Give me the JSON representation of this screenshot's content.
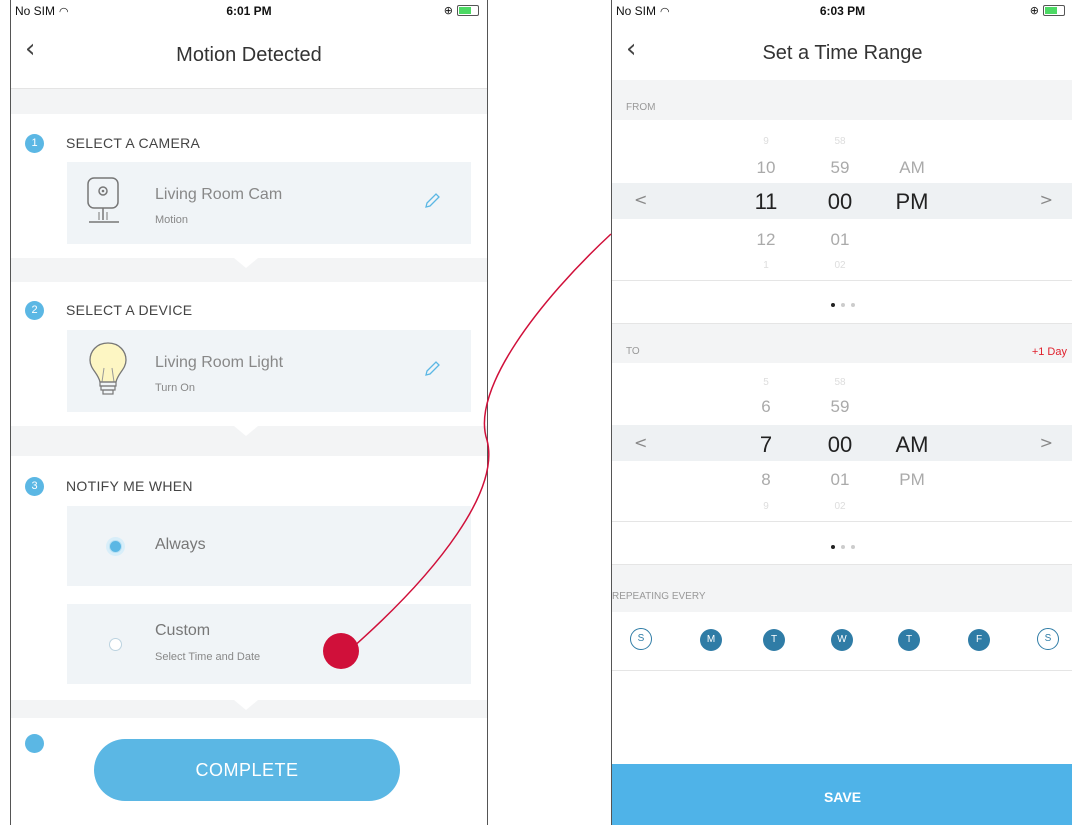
{
  "left": {
    "status": {
      "carrier": "No SIM",
      "time": "6:01 PM"
    },
    "title": "Motion Detected",
    "steps": [
      {
        "num": "1",
        "title": "SELECT A CAMERA",
        "item_name": "Living Room Cam",
        "item_sub": "Motion"
      },
      {
        "num": "2",
        "title": "SELECT A DEVICE",
        "item_name": "Living Room Light",
        "item_sub": "Turn On"
      },
      {
        "num": "3",
        "title": "NOTIFY ME WHEN"
      }
    ],
    "options": [
      {
        "label": "Always",
        "selected": true
      },
      {
        "label": "Custom",
        "sub": "Select Time and Date",
        "selected": false
      }
    ],
    "complete_label": "COMPLETE"
  },
  "right": {
    "status": {
      "carrier": "No SIM",
      "time": "6:03 PM"
    },
    "title": "Set a Time Range",
    "from": {
      "label": "FROM",
      "hours": [
        "9",
        "10",
        "11",
        "12",
        "1"
      ],
      "minutes": [
        "58",
        "59",
        "00",
        "01",
        "02"
      ],
      "ampm": [
        "AM",
        "PM"
      ]
    },
    "to": {
      "label": "TO",
      "extra": "+1 Day",
      "hours": [
        "5",
        "6",
        "7",
        "8",
        "9"
      ],
      "minutes": [
        "58",
        "59",
        "00",
        "01",
        "02"
      ],
      "ampm": [
        "AM",
        "PM"
      ]
    },
    "repeat_label": "REPEATING EVERY",
    "days": [
      {
        "letter": "S",
        "on": false
      },
      {
        "letter": "M",
        "on": true
      },
      {
        "letter": "T",
        "on": true
      },
      {
        "letter": "W",
        "on": true
      },
      {
        "letter": "T",
        "on": true
      },
      {
        "letter": "F",
        "on": true
      },
      {
        "letter": "S",
        "on": false
      }
    ],
    "save_label": "SAVE"
  },
  "colors": {
    "accent": "#5bb7e4",
    "day_on": "#2f7ca6",
    "annotation": "#d0103a",
    "plus_day": "#e0212d"
  }
}
